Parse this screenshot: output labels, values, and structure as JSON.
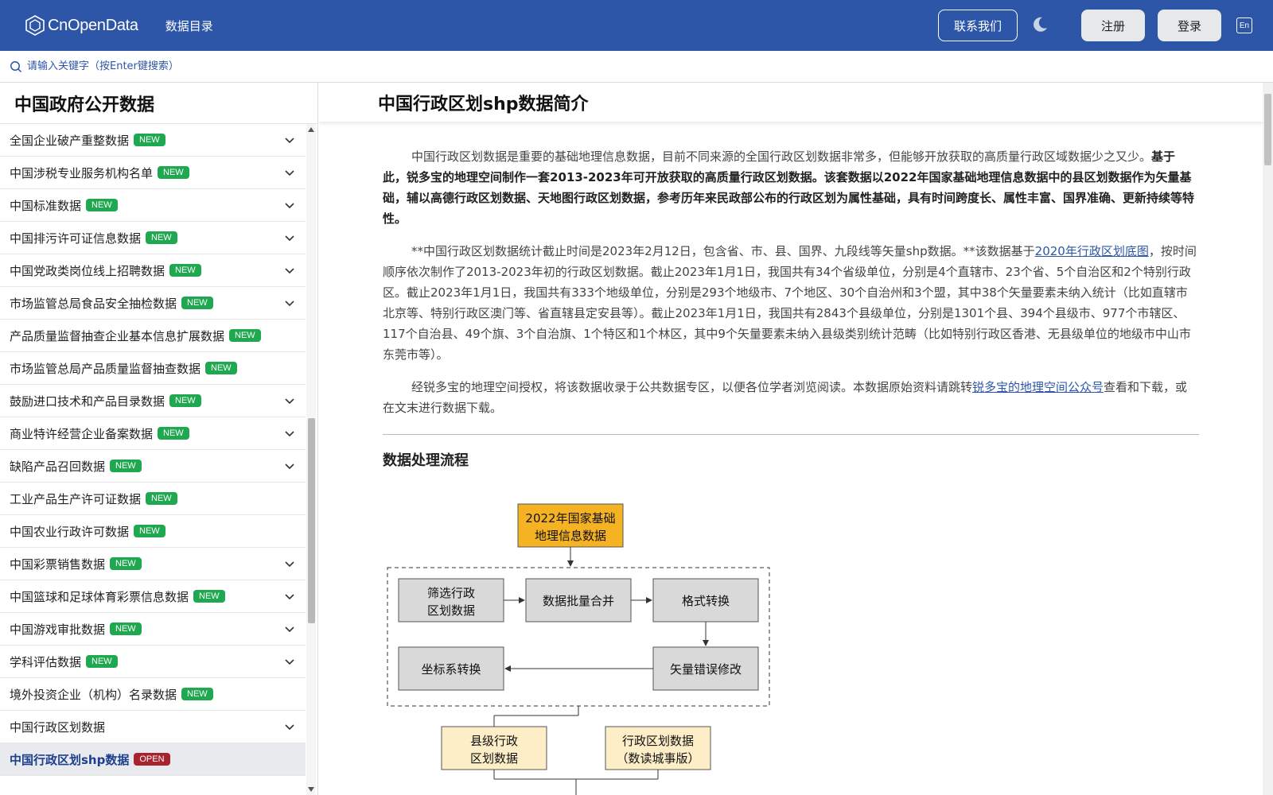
{
  "header": {
    "brand": "CnOpenData",
    "nav_catalog": "数据目录",
    "contact": "联系我们",
    "register": "注册",
    "login": "登录",
    "lang": "En"
  },
  "search": {
    "placeholder": "请输入关键字（按Enter键搜索）"
  },
  "sidebar": {
    "title": "中国政府公开数据",
    "items": [
      {
        "label": "全国企业破产重整数据",
        "badge": "NEW",
        "expand": true
      },
      {
        "label": "中国涉税专业服务机构名单",
        "badge": "NEW",
        "expand": true
      },
      {
        "label": "中国标准数据",
        "badge": "NEW",
        "expand": true
      },
      {
        "label": "中国排污许可证信息数据",
        "badge": "NEW",
        "expand": true
      },
      {
        "label": "中国党政类岗位线上招聘数据",
        "badge": "NEW",
        "expand": true
      },
      {
        "label": "市场监管总局食品安全抽检数据",
        "badge": "NEW",
        "expand": true
      },
      {
        "label": "产品质量监督抽查企业基本信息扩展数据",
        "badge": "NEW",
        "expand": false
      },
      {
        "label": "市场监管总局产品质量监督抽查数据",
        "badge": "NEW",
        "expand": false
      },
      {
        "label": "鼓励进口技术和产品目录数据",
        "badge": "NEW",
        "expand": true
      },
      {
        "label": "商业特许经营企业备案数据",
        "badge": "NEW",
        "expand": true
      },
      {
        "label": "缺陷产品召回数据",
        "badge": "NEW",
        "expand": true
      },
      {
        "label": "工业产品生产许可证数据",
        "badge": "NEW",
        "expand": false
      },
      {
        "label": "中国农业行政许可数据",
        "badge": "NEW",
        "expand": false
      },
      {
        "label": "中国彩票销售数据",
        "badge": "NEW",
        "expand": true
      },
      {
        "label": "中国篮球和足球体育彩票信息数据",
        "badge": "NEW",
        "expand": true
      },
      {
        "label": "中国游戏审批数据",
        "badge": "NEW",
        "expand": true
      },
      {
        "label": "学科评估数据",
        "badge": "NEW",
        "expand": true
      },
      {
        "label": "境外投资企业（机构）名录数据",
        "badge": "NEW",
        "expand": false
      },
      {
        "label": "中国行政区划数据",
        "badge": "",
        "expand": true
      },
      {
        "label": "中国行政区划shp数据",
        "badge": "OPEN",
        "expand": false,
        "active": true
      }
    ]
  },
  "main": {
    "title": "中国行政区划shp数据简介",
    "p1_normal": "中国行政区划数据是重要的基础地理信息数据，目前不同来源的全国行政区划数据非常多，但能够开放获取的高质量行政区域数据少之又少。",
    "p1_bold": "基于此，锐多宝的地理空间制作一套2013-2023年可开放获取的高质量行政区划数据。该套数据以2022年国家基础地理信息数据中的县区划数据作为矢量基础，辅以高德行政区划数据、天地图行政区划数据，参考历年来民政部公布的行政区划为属性基础，具有时间跨度长、属性丰富、国界准确、更新持续等特性。",
    "p2_a": "**中国行政区划数据统计截止时间是2023年2月12日，包含省、市、县、国界、九段线等矢量shp数据。**该数据基于",
    "p2_link": "2020年行政区划底图",
    "p2_b": "，按时间顺序依次制作了2013-2023年初的行政区划数据。截止2023年1月1日，我国共有34个省级单位，分别是4个直辖市、23个省、5个自治区和2个特别行政区。截止2023年1月1日，我国共有333个地级单位，分别是293个地级市、7个地区、30个自治州和3个盟，其中38个矢量要素未纳入统计（比如直辖市北京等、特别行政区澳门等、省直辖县定安县等）。截止2023年1月1日，我国共有2843个县级单位，分别是1301个县、394个县级市、977个市辖区、117个自治县、49个旗、3个自治旗、1个特区和1个林区，其中9个矢量要素未纳入县级类别统计范畴（比如特别行政区香港、无县级单位的地级市中山市东莞市等）。",
    "p3_a": "经锐多宝的地理空间授权，将该数据收录于公共数据专区，以便各位学者浏览阅读。本数据原始资料请跳转",
    "p3_link": "锐多宝的地理空间公众号",
    "p3_b": "查看和下载，或在文末进行数据下载。",
    "section_title": "数据处理流程",
    "flow": {
      "top_l1": "2022年国家基础",
      "top_l2": "地理信息数据",
      "b1_l1": "筛选行政",
      "b1_l2": "区划数据",
      "b2": "数据批量合并",
      "b3": "格式转换",
      "b4": "坐标系转换",
      "b5": "矢量错误修改",
      "b6_l1": "县级行政",
      "b6_l2": "区划数据",
      "b7_l1": "行政区划数据",
      "b7_l2": "（数读城事版）"
    }
  },
  "colors": {
    "header": "#2e56a8",
    "badge_new": "#1fa84f",
    "badge_open": "#a7232e",
    "flow_top": "#f5b223",
    "flow_box": "#d9d9d9",
    "flow_out": "#fdeec7"
  }
}
